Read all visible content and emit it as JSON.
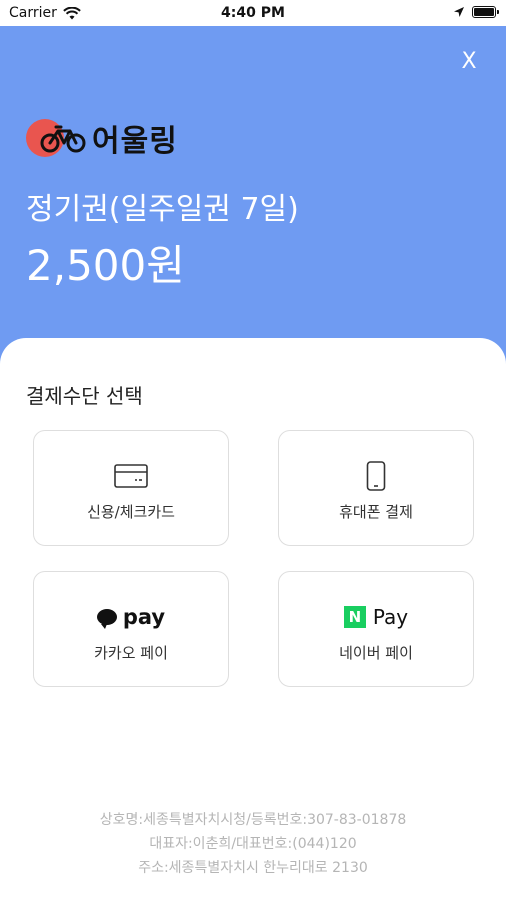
{
  "status_bar": {
    "carrier": "Carrier",
    "time": "4:40 PM",
    "icons": [
      "wifi-icon",
      "location-arrow-icon",
      "battery-icon"
    ]
  },
  "header": {
    "background": "#6f9bf2",
    "close_label": "X",
    "brand_name": "어울링",
    "brand_dot_color": "#e9554f",
    "product_name": "정기권(일주일권 7일)",
    "price": "2,500원"
  },
  "payment": {
    "title": "결제수단 선택",
    "methods": [
      {
        "label": "신용/체크카드",
        "icon": "credit-card-icon"
      },
      {
        "label": "휴대폰 결제",
        "icon": "mobile-phone-icon"
      },
      {
        "label": "카카오 페이",
        "icon": "kakao-pay-logo",
        "logo_text": "pay"
      },
      {
        "label": "네이버 페이",
        "icon": "naver-pay-logo",
        "logo_text": "Pay",
        "logo_letter": "N",
        "logo_color": "#19ce60"
      }
    ]
  },
  "footer": {
    "line1": "상호명:세종특별자치시청/등록번호:307-83-01878",
    "line2": "대표자:이춘희/대표번호:(044)120",
    "line3": "주소:세종특별자치시 한누리대로 2130"
  }
}
